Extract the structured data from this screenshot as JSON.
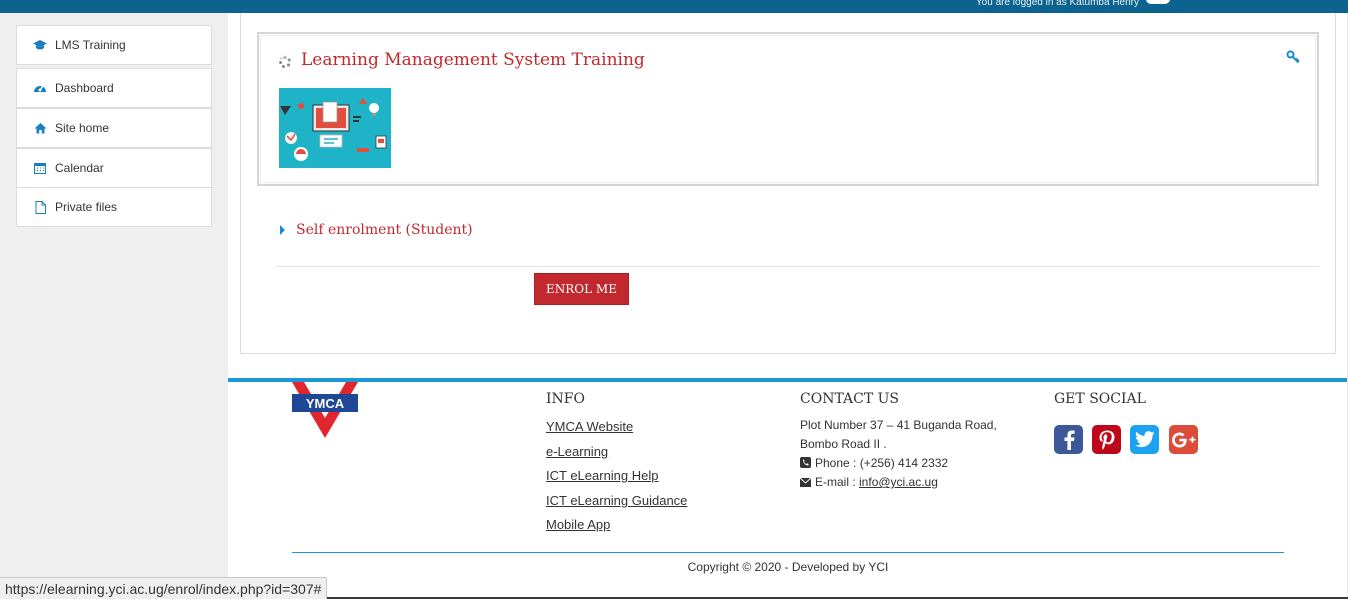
{
  "topbar": {
    "login_text": "You are logged in as Katumba Henry"
  },
  "sidebar": {
    "items": [
      {
        "label": "LMS Training",
        "icon": "graduation-cap-icon"
      },
      {
        "label": "Dashboard",
        "icon": "dashboard-icon"
      },
      {
        "label": "Site home",
        "icon": "home-icon"
      },
      {
        "label": "Calendar",
        "icon": "calendar-icon"
      },
      {
        "label": "Private files",
        "icon": "file-icon"
      }
    ]
  },
  "course": {
    "title": "Learning Management System Training"
  },
  "enrolment": {
    "section_title": "Self enrolment (Student)",
    "button_label": "ENROL ME"
  },
  "footer": {
    "logo_text": "YMCA",
    "info": {
      "heading": "INFO",
      "links": [
        "YMCA Website",
        "e-Learning",
        "ICT eLearning Help",
        "ICT eLearning Guidance",
        "Mobile App"
      ]
    },
    "contact": {
      "heading": "CONTACT US",
      "address_line1": "Plot Number 37 – 41 Buganda Road,",
      "address_line2": "Bombo Road II .",
      "phone": "Phone : (+256) 414 2332",
      "email_label": "E-mail : ",
      "email": "info@yci.ac.ug"
    },
    "social": {
      "heading": "GET SOCIAL",
      "networks": [
        {
          "name": "facebook-icon",
          "color": "#3b5998"
        },
        {
          "name": "pinterest-icon",
          "color": "#bd081c"
        },
        {
          "name": "twitter-icon",
          "color": "#1da1f2"
        },
        {
          "name": "google-plus-icon",
          "color": "#dd4b39"
        }
      ]
    },
    "copyright": "Copyright © 2020 - Developed by YCI"
  },
  "statusbar": {
    "url": "https://elearning.yci.ac.ug/enrol/index.php?id=307#"
  },
  "colors": {
    "topbar": "#0d6390",
    "accent_red": "#c1292e",
    "accent_blue": "#1b96d6"
  }
}
